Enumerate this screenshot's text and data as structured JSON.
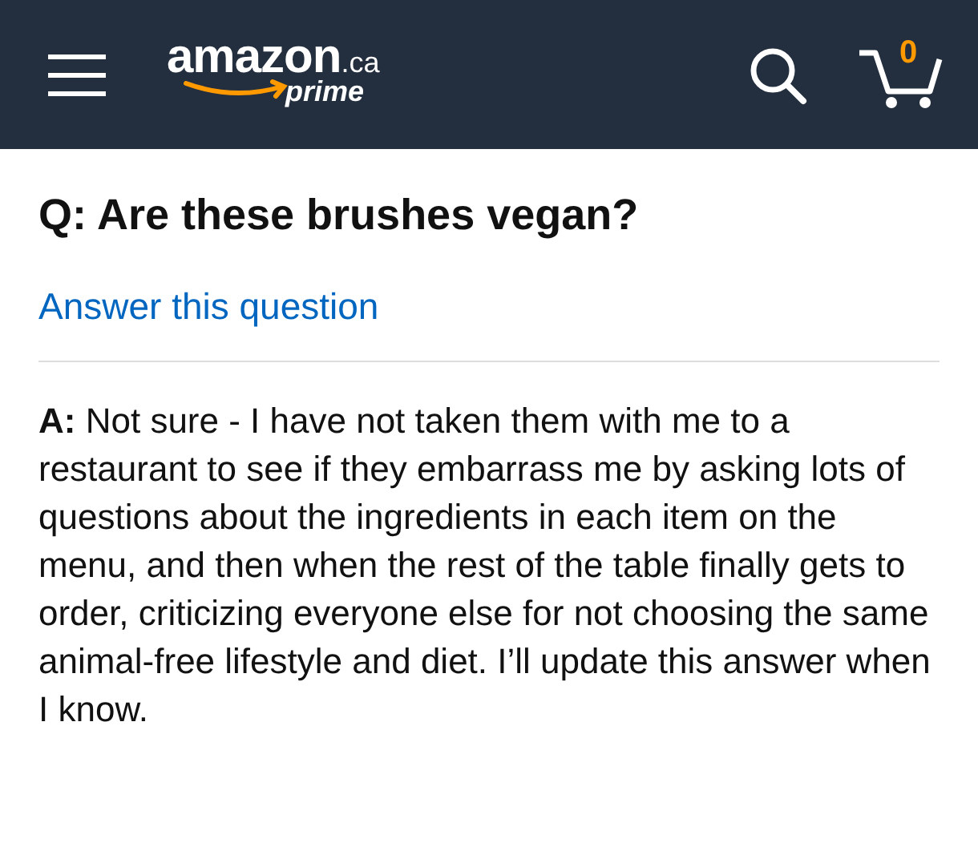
{
  "header": {
    "logo": {
      "name": "amazon",
      "suffix": ".ca",
      "tagline": "prime"
    },
    "cart": {
      "count": "0"
    }
  },
  "question": {
    "prefix": "Q:",
    "text": "Are these brushes vegan?"
  },
  "answer_link": "Answer this question",
  "answer": {
    "prefix": "A:",
    "text": "Not sure - I have not taken them with me to a restaurant to see if they embarrass me by asking lots of questions about the ingredients in each item on the menu, and then when the rest of the table finally gets to order, criticizing everyone else for not choosing the same animal-free lifestyle and diet. I’ll update this answer when I know."
  }
}
